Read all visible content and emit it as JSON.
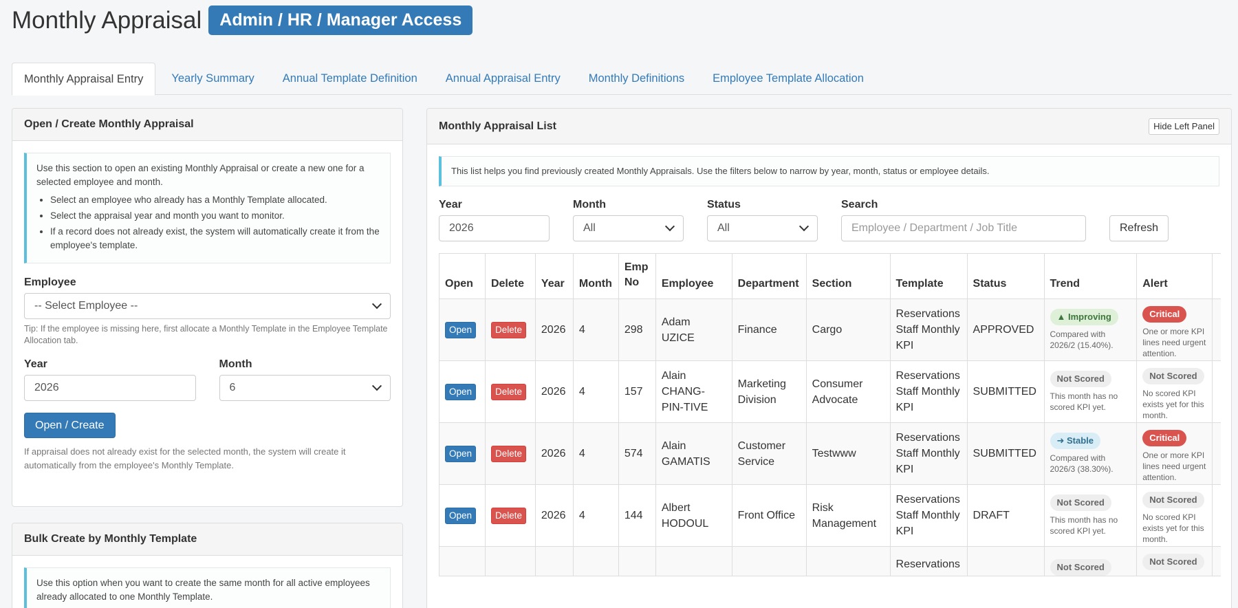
{
  "header": {
    "title": "Monthly Appraisal",
    "access_badge": "Admin / HR / Manager Access"
  },
  "tabs": [
    {
      "label": "Monthly Appraisal Entry",
      "active": true
    },
    {
      "label": "Yearly Summary"
    },
    {
      "label": "Annual Template Definition"
    },
    {
      "label": "Annual Appraisal Entry"
    },
    {
      "label": "Monthly Definitions"
    },
    {
      "label": "Employee Template Allocation"
    }
  ],
  "open_create": {
    "heading": "Open / Create Monthly Appraisal",
    "info_intro": "Use this section to open an existing Monthly Appraisal or create a new one for a selected employee and month.",
    "info_items": [
      "Select an employee who already has a Monthly Template allocated.",
      "Select the appraisal year and month you want to monitor.",
      "If a record does not already exist, the system will automatically create it from the employee's template."
    ],
    "employee_label": "Employee",
    "employee_value": "-- Select Employee --",
    "employee_tip": "Tip: If the employee is missing here, first allocate a Monthly Template in the Employee Template Allocation tab.",
    "year_label": "Year",
    "year_value": "2026",
    "month_label": "Month",
    "month_value": "6",
    "open_button": "Open / Create",
    "footer_note": "If appraisal does not already exist for the selected month, the system will create it automatically from the employee's Monthly Template."
  },
  "bulk_create": {
    "heading": "Bulk Create by Monthly Template",
    "info": "Use this option when you want to create the same month for all active employees already allocated to one Monthly Template."
  },
  "list": {
    "heading": "Monthly Appraisal List",
    "hide_button": "Hide Left Panel",
    "info": "This list helps you find previously created Monthly Appraisals. Use the filters below to narrow by year, month, status or employee details.",
    "filters": {
      "year_label": "Year",
      "year_value": "2026",
      "month_label": "Month",
      "month_value": "All",
      "status_label": "Status",
      "status_value": "All",
      "search_label": "Search",
      "search_placeholder": "Employee / Department / Job Title",
      "refresh_button": "Refresh"
    },
    "columns": [
      "Open",
      "Delete",
      "Year",
      "Month",
      "Emp No",
      "Employee",
      "Department",
      "Section",
      "Template",
      "Status",
      "Trend",
      "Alert"
    ],
    "open_label": "Open",
    "delete_label": "Delete",
    "rows": [
      {
        "year": "2026",
        "month": "4",
        "emp_no": "298",
        "employee": "Adam UZICE",
        "department": "Finance",
        "section": "Cargo",
        "template": "Reservations Staff Monthly KPI",
        "status": "APPROVED",
        "trend_badge": "▲ Improving",
        "trend_type": "improving",
        "trend_note": "Compared with 2026/2 (15.40%).",
        "alert_badge": "Critical",
        "alert_type": "critical",
        "alert_note": "One or more KPI lines need urgent attention."
      },
      {
        "year": "2026",
        "month": "4",
        "emp_no": "157",
        "employee": "Alain CHANG-PIN-TIVE",
        "department": "Marketing Division",
        "section": "Consumer Advocate",
        "template": "Reservations Staff Monthly KPI",
        "status": "SUBMITTED",
        "trend_badge": "Not Scored",
        "trend_type": "notscored",
        "trend_note": "This month has no scored KPI yet.",
        "alert_badge": "Not Scored",
        "alert_type": "notscored",
        "alert_note": "No scored KPI exists yet for this month."
      },
      {
        "year": "2026",
        "month": "4",
        "emp_no": "574",
        "employee": "Alain GAMATIS",
        "department": "Customer Service",
        "section": "Testwww",
        "template": "Reservations Staff Monthly KPI",
        "status": "SUBMITTED",
        "trend_badge": "➜ Stable",
        "trend_type": "stable",
        "trend_note": "Compared with 2026/3 (38.30%).",
        "alert_badge": "Critical",
        "alert_type": "critical",
        "alert_note": "One or more KPI lines need urgent attention."
      },
      {
        "year": "2026",
        "month": "4",
        "emp_no": "144",
        "employee": "Albert HODOUL",
        "department": "Front Office",
        "section": "Risk Management",
        "template": "Reservations Staff Monthly KPI",
        "status": "DRAFT",
        "trend_badge": "Not Scored",
        "trend_type": "notscored",
        "trend_note": "This month has no scored KPI yet.",
        "alert_badge": "Not Scored",
        "alert_type": "notscored",
        "alert_note": "No scored KPI exists yet for this month."
      }
    ],
    "partial_row": {
      "template": "Reservations",
      "trend_badge": "Not Scored",
      "alert_badge": "Not Scored"
    }
  }
}
